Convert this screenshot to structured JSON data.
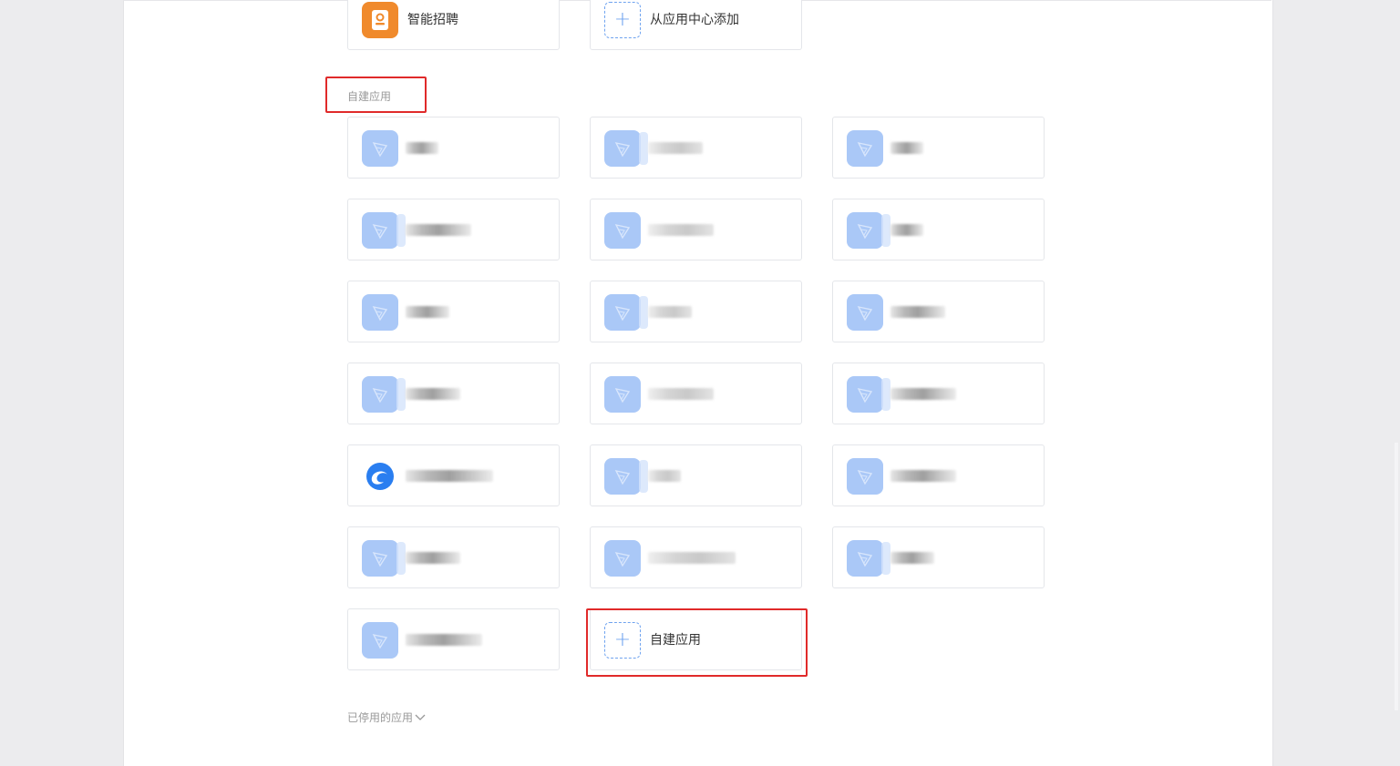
{
  "top_apps": [
    {
      "label": "智能招聘",
      "icon": "recruit-icon"
    },
    {
      "label": "从应用中心添加",
      "icon": "plus-icon"
    }
  ],
  "section": {
    "title": "自建应用"
  },
  "custom_apps_count": 19,
  "add_custom_app": {
    "label": "自建应用",
    "icon": "plus-icon"
  },
  "disabled_apps": {
    "label": "已停用的应用",
    "icon": "chevron-down-icon"
  },
  "colors": {
    "accent": "#3d86ee",
    "app_icon": "#aac8f7",
    "recruit_icon": "#f08a2c",
    "highlight": "#e02a2a"
  }
}
